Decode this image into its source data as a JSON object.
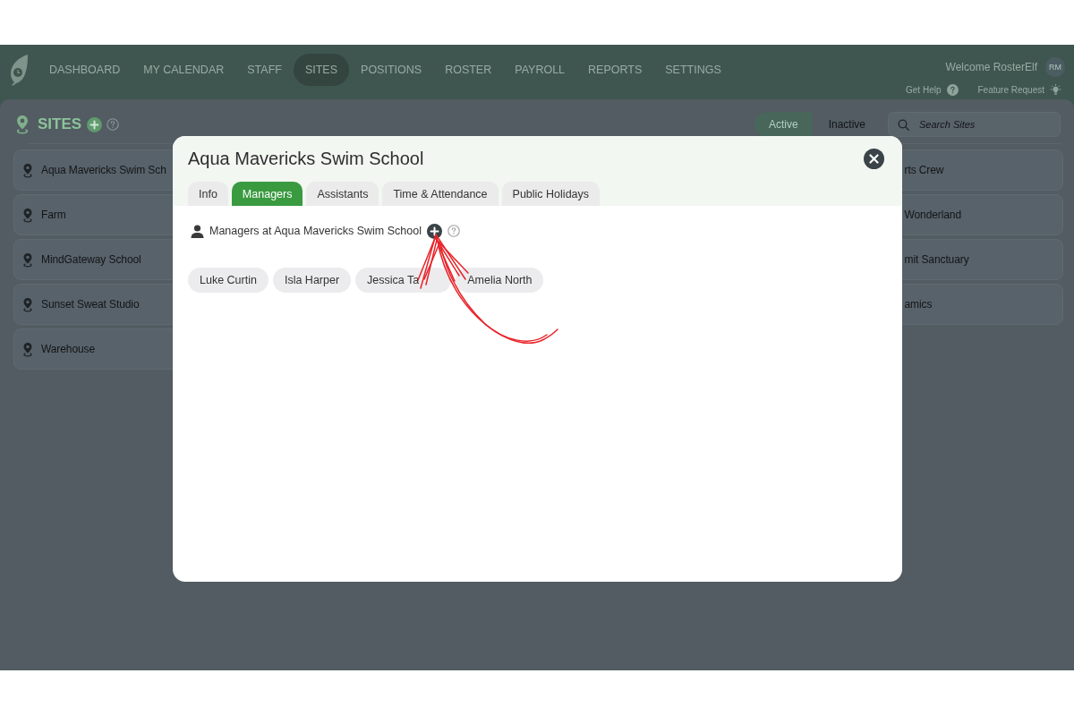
{
  "nav": {
    "items": [
      {
        "label": "DASHBOARD",
        "selected": false
      },
      {
        "label": "MY CALENDAR",
        "selected": false
      },
      {
        "label": "STAFF",
        "selected": false
      },
      {
        "label": "SITES",
        "selected": true
      },
      {
        "label": "POSITIONS",
        "selected": false
      },
      {
        "label": "ROSTER",
        "selected": false
      },
      {
        "label": "PAYROLL",
        "selected": false
      },
      {
        "label": "REPORTS",
        "selected": false
      },
      {
        "label": "SETTINGS",
        "selected": false
      }
    ],
    "welcome": "Welcome RosterElf",
    "avatar": "RM",
    "links": [
      {
        "label": "Get Help",
        "kind": "help"
      },
      {
        "label": "Feature Request",
        "kind": "idea"
      }
    ]
  },
  "sites_page": {
    "title": "SITES",
    "filters": [
      {
        "label": "Active",
        "selected": true
      },
      {
        "label": "Inactive",
        "selected": false
      }
    ],
    "search": {
      "placeholder": "Search Sites"
    },
    "left_column": [
      "Aqua Mavericks Swim Sch",
      "Farm",
      "MindGateway School",
      "Sunset Sweat Studio",
      "Warehouse"
    ],
    "right_column": [
      "rts Crew",
      "Wonderland",
      "mit Sanctuary",
      "amics"
    ]
  },
  "modal": {
    "title": "Aqua Mavericks Swim School",
    "tabs": [
      {
        "label": "Info",
        "selected": false
      },
      {
        "label": "Managers",
        "selected": true
      },
      {
        "label": "Assistants",
        "selected": false
      },
      {
        "label": "Time & Attendance",
        "selected": false
      },
      {
        "label": "Public Holidays",
        "selected": false
      }
    ],
    "section_title": "Managers at Aqua Mavericks Swim School",
    "managers": [
      "Luke Curtin",
      "Isla Harper",
      "Jessica Ta",
      "Amelia North"
    ]
  }
}
